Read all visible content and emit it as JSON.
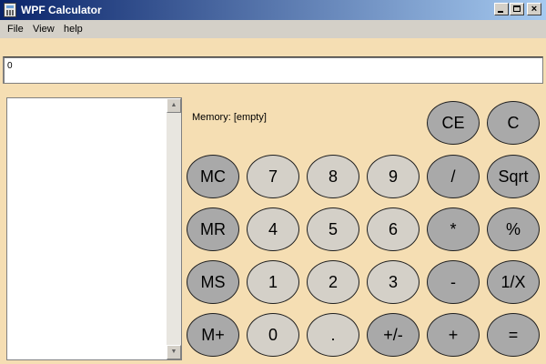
{
  "window": {
    "title": "WPF Calculator",
    "icon": "calculator-icon",
    "controls": {
      "minimize": "minimize-icon",
      "maximize": "maximize-icon",
      "close": "×"
    }
  },
  "menu": {
    "file": "File",
    "view": "View",
    "help": "help"
  },
  "display": {
    "value": "0"
  },
  "memory": {
    "label": "Memory: [empty]"
  },
  "scrollbar": {
    "up": "▲",
    "down": "▼"
  },
  "buttons": {
    "ce": "CE",
    "c": "C",
    "mc": "MC",
    "n7": "7",
    "n8": "8",
    "n9": "9",
    "divide": "/",
    "sqrt": "Sqrt",
    "mr": "MR",
    "n4": "4",
    "n5": "5",
    "n6": "6",
    "multiply": "*",
    "percent": "%",
    "ms": "MS",
    "n1": "1",
    "n2": "2",
    "n3": "3",
    "minus": "-",
    "reciprocal": "1/X",
    "mplus": "M+",
    "n0": "0",
    "dot": ".",
    "negate": "+/-",
    "plus": "+",
    "equals": "="
  },
  "colors": {
    "background": "#f5deb3",
    "button_dark": "#a9a9a9",
    "button_light": "#d4d0c8",
    "title_start": "#0a246a",
    "title_end": "#a6caf0"
  }
}
